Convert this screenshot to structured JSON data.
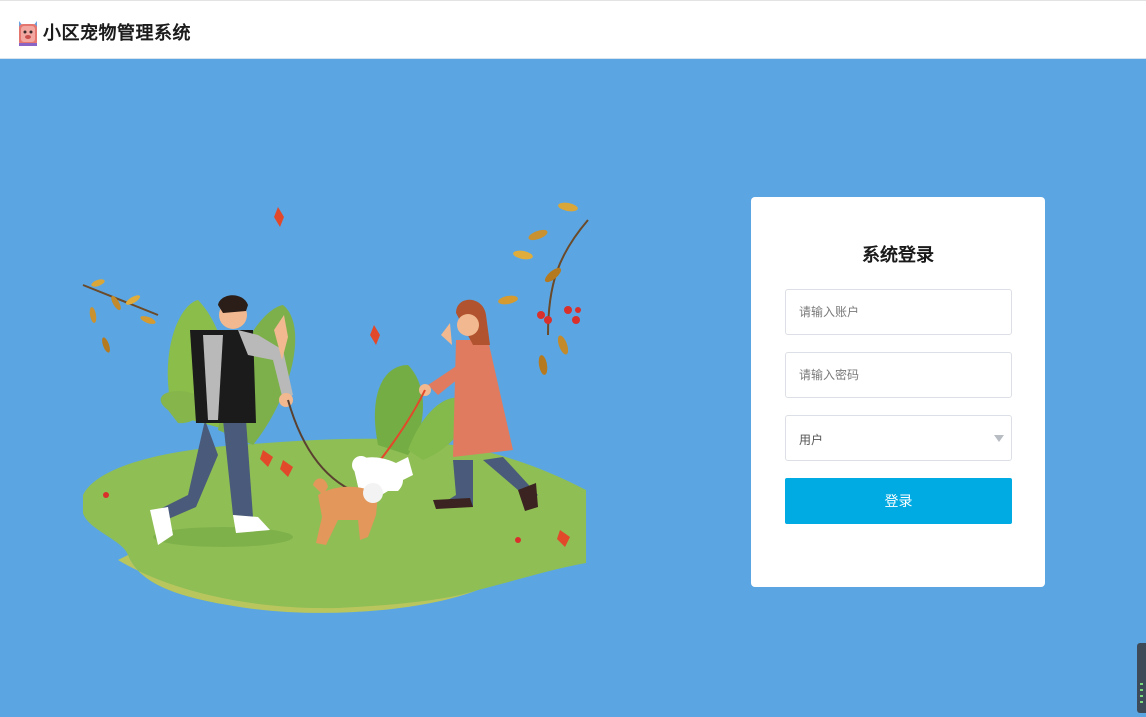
{
  "header": {
    "app_title": "小区宠物管理系统",
    "logo_icon": "pet-face-logo-icon"
  },
  "login": {
    "title": "系统登录",
    "account": {
      "value": "",
      "placeholder": "请输入账户"
    },
    "password": {
      "value": "",
      "placeholder": "请输入密码"
    },
    "role": {
      "selected": "用户"
    },
    "submit_label": "登录"
  },
  "colors": {
    "page_background": "#5ba6e2",
    "button": "#00aae2",
    "card": "#ffffff"
  },
  "icons": {
    "illustration": "couple-walking-dogs-illustration",
    "select_caret": "caret-down-icon"
  }
}
